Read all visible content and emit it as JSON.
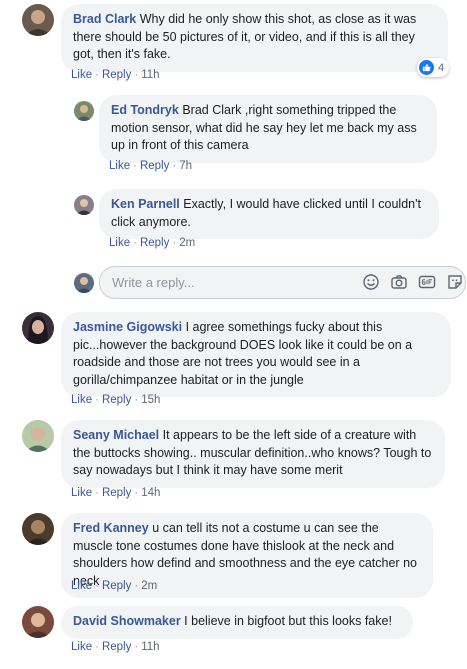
{
  "comments": [
    {
      "author": "Brad Clark",
      "text": "Why did he only show this shot, as close as it was there should be 50 pictures of it, or video, and if this is all they got, then it's fake.",
      "like": "Like",
      "reply": "Reply",
      "time": "11h",
      "reaction_count": "4"
    },
    {
      "author": "Ed Tondryk",
      "text": "Brad Clark ,right something tripped the motion sensor, what did he say hey let me back my ass up in front of this camera",
      "like": "Like",
      "reply": "Reply",
      "time": "7h"
    },
    {
      "author": "Ken Parnell",
      "text": "Exactly, I would have clicked until I couldn't click anymore.",
      "like": "Like",
      "reply": "Reply",
      "time": "2m"
    },
    {
      "author": "Jasmine Gigowski",
      "text": "I agree somethings fucky about this pic...however the background DOES look like it could be on a roadside and those are not trees you would see in a gorilla/chimpanzee habitat or in the jungle",
      "like": "Like",
      "reply": "Reply",
      "time": "15h"
    },
    {
      "author": "Seany Michael",
      "text": "It appears to be the left side of a creature with the buttocks showing.. muscular definition..who knows? Tough to say nowadays but I think it may have some merit",
      "like": "Like",
      "reply": "Reply",
      "time": "14h"
    },
    {
      "author": "Fred Kanney",
      "text": "u can tell its not a costume u can see the muscle tone costumes done have thislook at the neck and shoulders how defind and smoothness and the eye catcher no neck",
      "like": "Like",
      "reply": "Reply",
      "time": "2m"
    },
    {
      "author": "David Showmaker",
      "text": "I believe in bigfoot but this looks fake!",
      "like": "Like",
      "reply": "Reply",
      "time": "11h"
    }
  ],
  "reply_box": {
    "placeholder": "Write a reply..."
  },
  "icons": {
    "reaction": "like-thumb-icon",
    "tools": [
      "emoji-icon",
      "camera-icon",
      "gif-icon",
      "sticker-icon"
    ]
  },
  "colors": {
    "name": "#385898",
    "bubble": "#f2f3f5",
    "meta": "#606770",
    "like_badge": "#1877f2"
  }
}
